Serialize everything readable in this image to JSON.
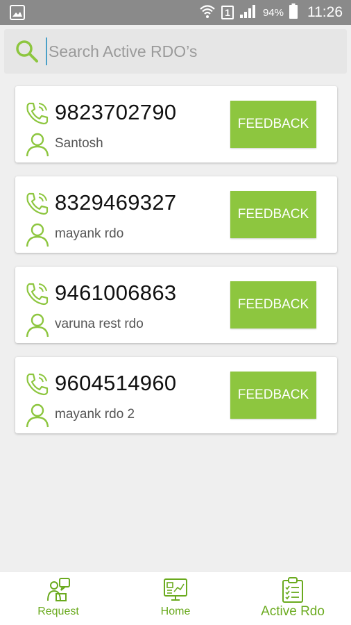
{
  "status_bar": {
    "battery_percent": "94%",
    "sim_slot": "1",
    "time": "11:26",
    "icons": [
      "gallery-notification-icon",
      "wifi-icon",
      "sim-icon",
      "signal-icon",
      "battery-icon"
    ]
  },
  "search": {
    "placeholder": "Search Active RDO’s",
    "value": ""
  },
  "rdo_list": [
    {
      "phone": "9823702790",
      "name": "Santosh",
      "button_label": "FEEDBACK"
    },
    {
      "phone": "8329469327",
      "name": "mayank rdo",
      "button_label": "FEEDBACK"
    },
    {
      "phone": "9461006863",
      "name": "varuna rest rdo",
      "button_label": "FEEDBACK"
    },
    {
      "phone": "9604514960",
      "name": "mayank rdo 2",
      "button_label": "FEEDBACK"
    }
  ],
  "bottom_nav": {
    "items": [
      {
        "label": "Request",
        "icon": "request-icon",
        "active": false
      },
      {
        "label": "Home",
        "icon": "home-dashboard-icon",
        "active": false
      },
      {
        "label": "Active Rdo",
        "icon": "clipboard-icon",
        "active": true
      }
    ]
  },
  "colors": {
    "accent": "#8dc63f",
    "nav_label": "#6aaa1e",
    "status_bar": "#8a8a8a",
    "background": "#efefef"
  }
}
